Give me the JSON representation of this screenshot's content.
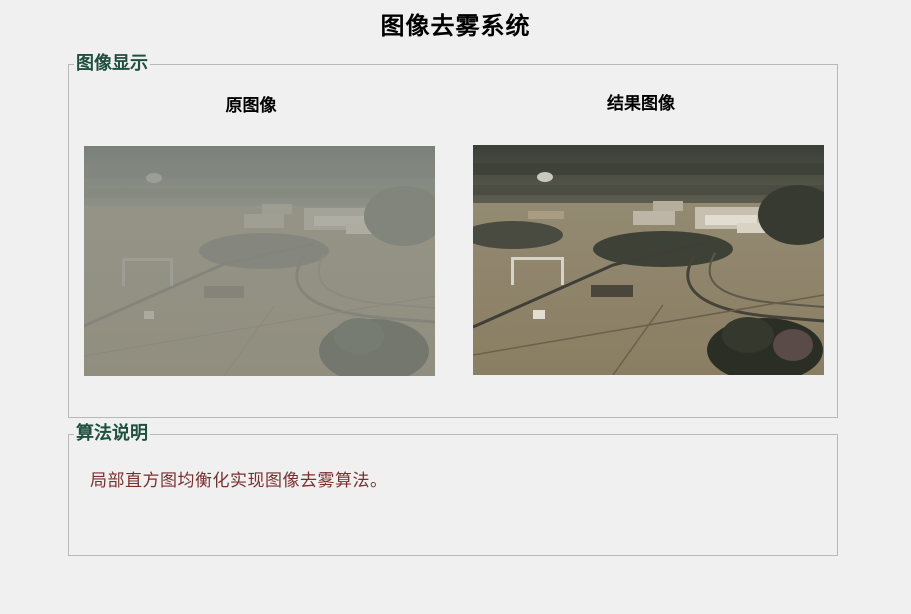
{
  "app": {
    "title": "图像去雾系统"
  },
  "display_panel": {
    "legend": "图像显示",
    "original": {
      "caption": "原图像"
    },
    "result": {
      "caption": "结果图像"
    }
  },
  "description_panel": {
    "legend": "算法说明",
    "text": "局部直方图均衡化实现图像去雾算法。"
  },
  "colors": {
    "background": "#f0f0f0",
    "legend_text": "#1f4f3f",
    "description_text": "#7a2f2f",
    "panel_border": "#b8b8b8"
  }
}
